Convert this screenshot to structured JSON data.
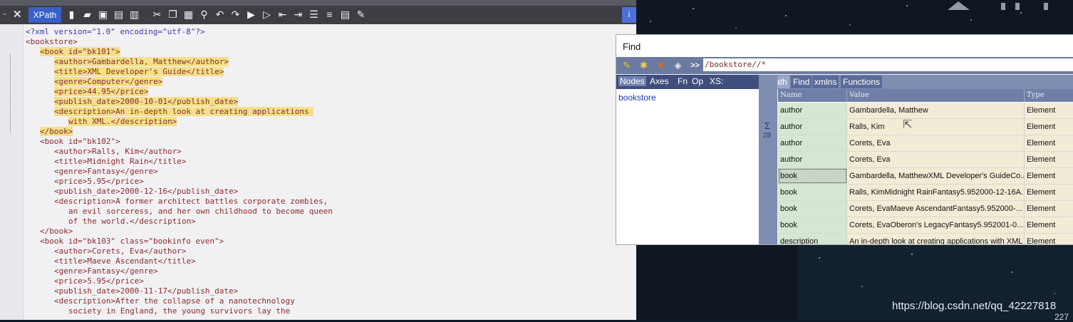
{
  "editor": {
    "toolbar": {
      "xpath_tab": "XPath",
      "icons": [
        "new-file-icon",
        "open-folder-icon",
        "save-icon",
        "save-as-icon",
        "print-icon",
        "cut-icon",
        "copy-icon",
        "paste-icon",
        "search-icon",
        "undo-icon",
        "redo-icon",
        "bookmark-icon",
        "bookmark-next-icon",
        "indent-left-icon",
        "indent-right-icon",
        "align-left-icon",
        "align-right-icon",
        "format-icon",
        "edit-icon"
      ],
      "info_label": "i"
    },
    "lines": [
      {
        "t": "<?xml version=\"1.0\" encoding=\"utf-8\"?>",
        "cls": "pi",
        "indent": 0,
        "hl": false
      },
      {
        "t": "<bookstore>",
        "cls": "tg",
        "indent": 0,
        "hl": false
      },
      {
        "t": "<book id=\"bk101\">",
        "cls": "tg",
        "indent": 2,
        "hl": true
      },
      {
        "t": "<author>Gambardella, Matthew</author>",
        "cls": "tg",
        "indent": 4,
        "hl": true
      },
      {
        "t": "<title>XML Developer's Guide</title>",
        "cls": "tg",
        "indent": 4,
        "hl": true
      },
      {
        "t": "<genre>Computer</genre>",
        "cls": "tg",
        "indent": 4,
        "hl": true
      },
      {
        "t": "<price>44.95</price>",
        "cls": "tg",
        "indent": 4,
        "hl": true
      },
      {
        "t": "<publish_date>2000-10-01</publish_date>",
        "cls": "tg",
        "indent": 4,
        "hl": true
      },
      {
        "t": "<description>An in-depth look at creating applications ",
        "cls": "tg",
        "indent": 4,
        "hl": true
      },
      {
        "t": "with XML.</description>",
        "cls": "tg",
        "indent": 6,
        "hl": true
      },
      {
        "t": "</book>",
        "cls": "tg",
        "indent": 2,
        "hl": true
      },
      {
        "t": "<book id=\"bk102\">",
        "cls": "tg",
        "indent": 2,
        "hl": false
      },
      {
        "t": "<author>Ralls, Kim</author>",
        "cls": "tg",
        "indent": 4,
        "hl": false
      },
      {
        "t": "<title>Midnight Rain</title>",
        "cls": "tg",
        "indent": 4,
        "hl": false
      },
      {
        "t": "<genre>Fantasy</genre>",
        "cls": "tg",
        "indent": 4,
        "hl": false
      },
      {
        "t": "<price>5.95</price>",
        "cls": "tg",
        "indent": 4,
        "hl": false
      },
      {
        "t": "<publish_date>2000-12-16</publish_date>",
        "cls": "tg",
        "indent": 4,
        "hl": false
      },
      {
        "t": "<description>A former architect battles corporate zombies,",
        "cls": "tg",
        "indent": 4,
        "hl": false
      },
      {
        "t": "an evil sorceress, and her own childhood to become queen",
        "cls": "tg",
        "indent": 6,
        "hl": false
      },
      {
        "t": "of the world.</description>",
        "cls": "tg",
        "indent": 6,
        "hl": false
      },
      {
        "t": "</book>",
        "cls": "tg",
        "indent": 2,
        "hl": false
      },
      {
        "t": "<book id=\"bk103\" class=\"bookinfo even\">",
        "cls": "tg",
        "indent": 2,
        "hl": false
      },
      {
        "t": "<author>Corets, Eva</author>",
        "cls": "tg",
        "indent": 4,
        "hl": false
      },
      {
        "t": "<title>Maeve Ascendant</title>",
        "cls": "tg",
        "indent": 4,
        "hl": false
      },
      {
        "t": "<genre>Fantasy</genre>",
        "cls": "tg",
        "indent": 4,
        "hl": false
      },
      {
        "t": "<price>5.95</price>",
        "cls": "tg",
        "indent": 4,
        "hl": false
      },
      {
        "t": "<publish_date>2000-11-17</publish_date>",
        "cls": "tg",
        "indent": 4,
        "hl": false
      },
      {
        "t": "<description>After the collapse of a nanotechnology",
        "cls": "tg",
        "indent": 4,
        "hl": false
      },
      {
        "t": "society in England, the young survivors lay the",
        "cls": "tg",
        "indent": 6,
        "hl": false
      }
    ]
  },
  "find": {
    "title": "Find",
    "xpath_query": "/bookstore//*",
    "run_label": ">>",
    "left_tabs": [
      "Nodes",
      "Axes",
      "Fn",
      "Op",
      "XS:"
    ],
    "right_tabs": [
      "XPath",
      "Find",
      "xmlns",
      "Functions"
    ],
    "tree_root": "bookstore",
    "sigma": "Σ",
    "result_count": "28",
    "columns": [
      "Name",
      "Value",
      "Type"
    ],
    "rows": [
      {
        "name": "author",
        "value": "Gambardella, Matthew",
        "type": "Element"
      },
      {
        "name": "author",
        "value": "Ralls, Kim",
        "type": "Element"
      },
      {
        "name": "author",
        "value": "Corets, Eva",
        "type": "Element"
      },
      {
        "name": "author",
        "value": "Corets, Eva",
        "type": "Element"
      },
      {
        "name": "book",
        "value": "Gambardella, MatthewXML Developer's GuideCo...",
        "type": "Element"
      },
      {
        "name": "book",
        "value": "Ralls, KimMidnight RainFantasy5.952000-12-16A...",
        "type": "Element"
      },
      {
        "name": "book",
        "value": "Corets, EvaMaeve AscendantFantasy5.952000-...",
        "type": "Element"
      },
      {
        "name": "book",
        "value": "Corets, EvaOberon's LegacyFantasy5.952001-0...",
        "type": "Element"
      },
      {
        "name": "description",
        "value": "An in-depth look at creating applications with XML",
        "type": "Element"
      }
    ],
    "selected_row": 4
  },
  "watermark": "https://blog.csdn.net/qq_42227818",
  "corner_number": "227"
}
